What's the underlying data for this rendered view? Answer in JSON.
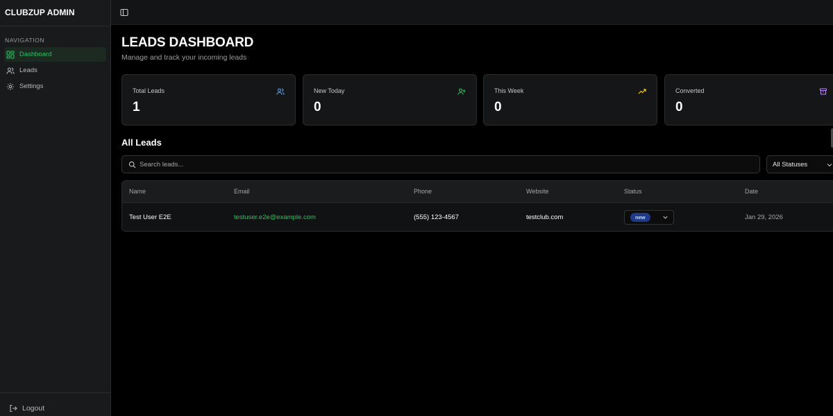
{
  "app": {
    "title": "CLUBZUP ADMIN"
  },
  "sidebar": {
    "section_label": "NAVIGATION",
    "items": [
      {
        "label": "Dashboard",
        "icon": "dashboard-icon",
        "active": true
      },
      {
        "label": "Leads",
        "icon": "users-icon",
        "active": false
      },
      {
        "label": "Settings",
        "icon": "gear-icon",
        "active": false
      }
    ],
    "logout_label": "Logout"
  },
  "page": {
    "title": "LEADS DASHBOARD",
    "subtitle": "Manage and track your incoming leads"
  },
  "stats": [
    {
      "label": "Total Leads",
      "value": "1",
      "icon": "users-icon",
      "color": "#60a5fa"
    },
    {
      "label": "New Today",
      "value": "0",
      "icon": "user-plus-icon",
      "color": "#22c55e"
    },
    {
      "label": "This Week",
      "value": "0",
      "icon": "trending-up-icon",
      "color": "#facc15"
    },
    {
      "label": "Converted",
      "value": "0",
      "icon": "archive-icon",
      "color": "#c084fc"
    }
  ],
  "leads": {
    "section_title": "All Leads",
    "search_placeholder": "Search leads...",
    "status_filter": "All Statuses",
    "columns": [
      "Name",
      "Email",
      "Phone",
      "Website",
      "Status",
      "Date"
    ],
    "rows": [
      {
        "name": "Test User E2E",
        "email": "testuser.e2e@example.com",
        "phone": "(555) 123-4567",
        "website": "testclub.com",
        "status": "new",
        "date": "Jan 29, 2026"
      }
    ]
  },
  "colors": {
    "accent": "#22c55e",
    "badge_new_bg": "#1e3a8a",
    "badge_new_text": "#bfdbfe"
  }
}
